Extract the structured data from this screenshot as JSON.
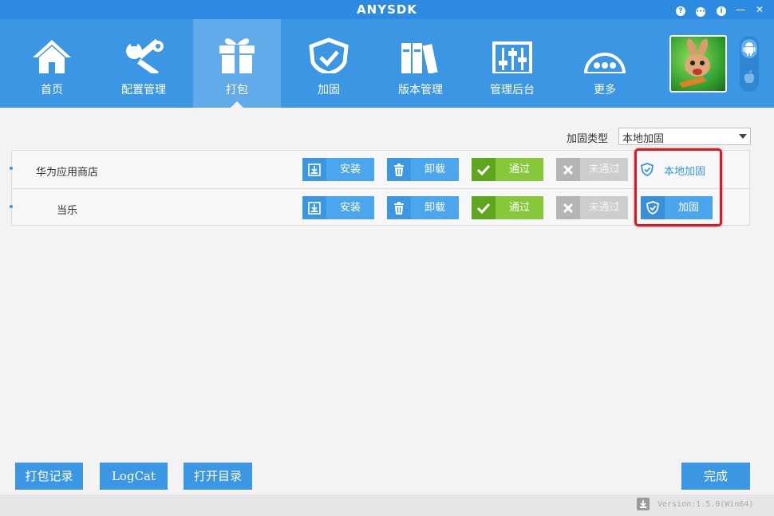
{
  "window": {
    "title": "ANYSDK",
    "controls": {
      "help": "?",
      "chat": "•••",
      "info": "i",
      "minimize": "—",
      "close": "✕"
    }
  },
  "nav": {
    "items": [
      {
        "label": "首页",
        "icon": "home-icon"
      },
      {
        "label": "配置管理",
        "icon": "tools-icon"
      },
      {
        "label": "打包",
        "icon": "gift-icon"
      },
      {
        "label": "加固",
        "icon": "shield-icon"
      },
      {
        "label": "版本管理",
        "icon": "books-icon"
      },
      {
        "label": "管理后台",
        "icon": "sliders-icon"
      },
      {
        "label": "更多",
        "icon": "more-icon"
      }
    ],
    "active": "打包"
  },
  "platform": {
    "options": [
      "android-icon",
      "apple-icon"
    ],
    "selected": "android"
  },
  "harden_type": {
    "label": "加固类型",
    "value": "本地加固"
  },
  "rows": [
    {
      "name": "华为应用商店",
      "install": "安装",
      "uninstall": "卸载",
      "pass": "通过",
      "fail": "未通过",
      "harden": "本地加固"
    },
    {
      "name": "当乐",
      "install": "安装",
      "uninstall": "卸载",
      "pass": "通过",
      "fail": "未通过",
      "harden": "加固"
    }
  ],
  "footer": {
    "history": "打包记录",
    "logcat": "LogCat",
    "open_dir": "打开目录",
    "done": "完成",
    "version": "Version:1.5.0(Win64)"
  },
  "colors": {
    "primary": "#3b96e3",
    "title_bar": "#2c8be0",
    "pass_green": "#86c83a",
    "fail_gray": "#cdcdcd",
    "highlight_red": "#e3151e"
  }
}
